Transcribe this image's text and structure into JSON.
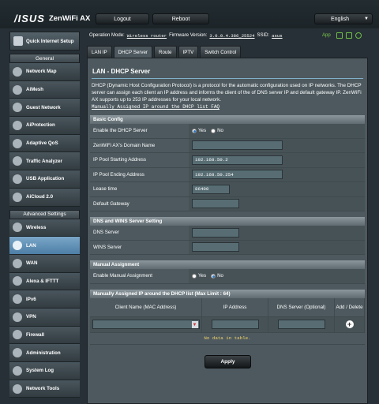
{
  "header": {
    "brand": "/ISUS",
    "product": "ZenWiFi AX",
    "logout": "Logout",
    "reboot": "Reboot",
    "language": "English"
  },
  "status": {
    "op_mode_label": "Operation Mode:",
    "op_mode_value": "Wireless router",
    "fw_label": "Firmware Version:",
    "fw_value": "3.0.0.4.386_25524",
    "ssid_label": "SSID:",
    "ssid_value": "asus",
    "app": "App"
  },
  "sidebar": {
    "qis": "Quick Internet Setup",
    "general_title": "General",
    "general": [
      "Network Map",
      "AiMesh",
      "Guest Network",
      "AiProtection",
      "Adaptive QoS",
      "Traffic Analyzer",
      "USB Application",
      "AiCloud 2.0"
    ],
    "advanced_title": "Advanced Settings",
    "advanced": [
      "Wireless",
      "LAN",
      "WAN",
      "Alexa & IFTTT",
      "IPv6",
      "VPN",
      "Firewall",
      "Administration",
      "System Log",
      "Network Tools"
    ],
    "active": "LAN"
  },
  "tabs": [
    "LAN IP",
    "DHCP Server",
    "Route",
    "IPTV",
    "Switch Control"
  ],
  "active_tab": "DHCP Server",
  "main": {
    "title": "LAN - DHCP Server",
    "description": "DHCP (Dynamic Host Configuration Protocol) is a protocol for the automatic configuration used on IP networks. The DHCP server can assign each client an IP address and informs the client of the of DNS server IP and default gateway IP. ZenWiFi AX supports up to 253 IP addresses for your local network.",
    "faq_link": "Manually Assigned IP around the DHCP list FAQ"
  },
  "basic": {
    "title": "Basic Config",
    "enable_label": "Enable the DHCP Server",
    "yes": "Yes",
    "no": "No",
    "domain_label": "ZenWiFi AX's Domain Name",
    "domain_value": "",
    "start_label": "IP Pool Starting Address",
    "start_value": "192.168.50.2",
    "end_label": "IP Pool Ending Address",
    "end_value": "192.168.50.254",
    "lease_label": "Lease time",
    "lease_value": "86400",
    "gateway_label": "Default Gateway",
    "gateway_value": ""
  },
  "dns": {
    "title": "DNS and WINS Server Setting",
    "dns_label": "DNS Server",
    "wins_label": "WINS Server"
  },
  "manual": {
    "title": "Manual Assignment",
    "enable_label": "Enable Manual Assignment",
    "yes": "Yes",
    "no": "No"
  },
  "list": {
    "title": "Manually Assigned IP around the DHCP list (Max Limit : 64)",
    "col_client": "Client Name (MAC Address)",
    "col_ip": "IP Address",
    "col_dns": "DNS Server (Optional)",
    "col_add": "Add / Delete",
    "empty": "No data in table."
  },
  "apply": "Apply"
}
